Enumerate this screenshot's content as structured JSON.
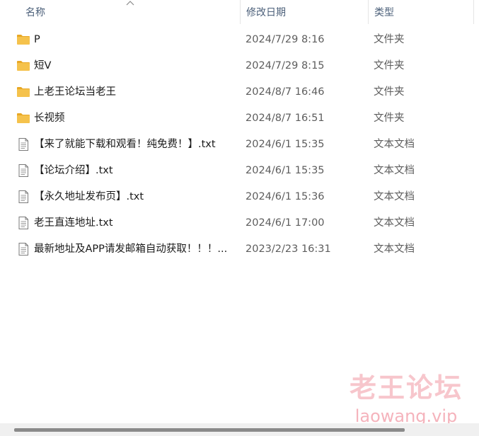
{
  "columns": {
    "name": "名称",
    "date": "修改日期",
    "type": "类型"
  },
  "sort": {
    "column": "name",
    "direction": "ascending",
    "icon": "sort-up-chevron-icon"
  },
  "icons": {
    "folder": "folder-icon",
    "file": "text-document-icon"
  },
  "colors": {
    "folder_body": "#f5c24c",
    "folder_tab": "#e8a825",
    "scroll_thumb": "#8a8a8a",
    "watermark": "#f4b6bf"
  },
  "files": [
    {
      "name": "P",
      "date": "2024/7/29 8:16",
      "type": "文件夹",
      "kind": "folder"
    },
    {
      "name": "短V",
      "date": "2024/7/29 8:15",
      "type": "文件夹",
      "kind": "folder"
    },
    {
      "name": "上老王论坛当老王",
      "date": "2024/8/7 16:46",
      "type": "文件夹",
      "kind": "folder"
    },
    {
      "name": "长视频",
      "date": "2024/8/7 16:51",
      "type": "文件夹",
      "kind": "folder"
    },
    {
      "name": "【来了就能下载和观看！纯免费！】.txt",
      "date": "2024/6/1 15:35",
      "type": "文本文档",
      "kind": "file"
    },
    {
      "name": "【论坛介绍】.txt",
      "date": "2024/6/1 15:35",
      "type": "文本文档",
      "kind": "file"
    },
    {
      "name": "【永久地址发布页】.txt",
      "date": "2024/6/1 15:36",
      "type": "文本文档",
      "kind": "file"
    },
    {
      "name": "老王直连地址.txt",
      "date": "2024/6/1 17:00",
      "type": "文本文档",
      "kind": "file"
    },
    {
      "name": "最新地址及APP请发邮箱自动获取！！！...",
      "date": "2023/2/23 16:31",
      "type": "文本文档",
      "kind": "file"
    }
  ],
  "watermark": {
    "title": "老王论坛",
    "url": "laowang.vip"
  }
}
